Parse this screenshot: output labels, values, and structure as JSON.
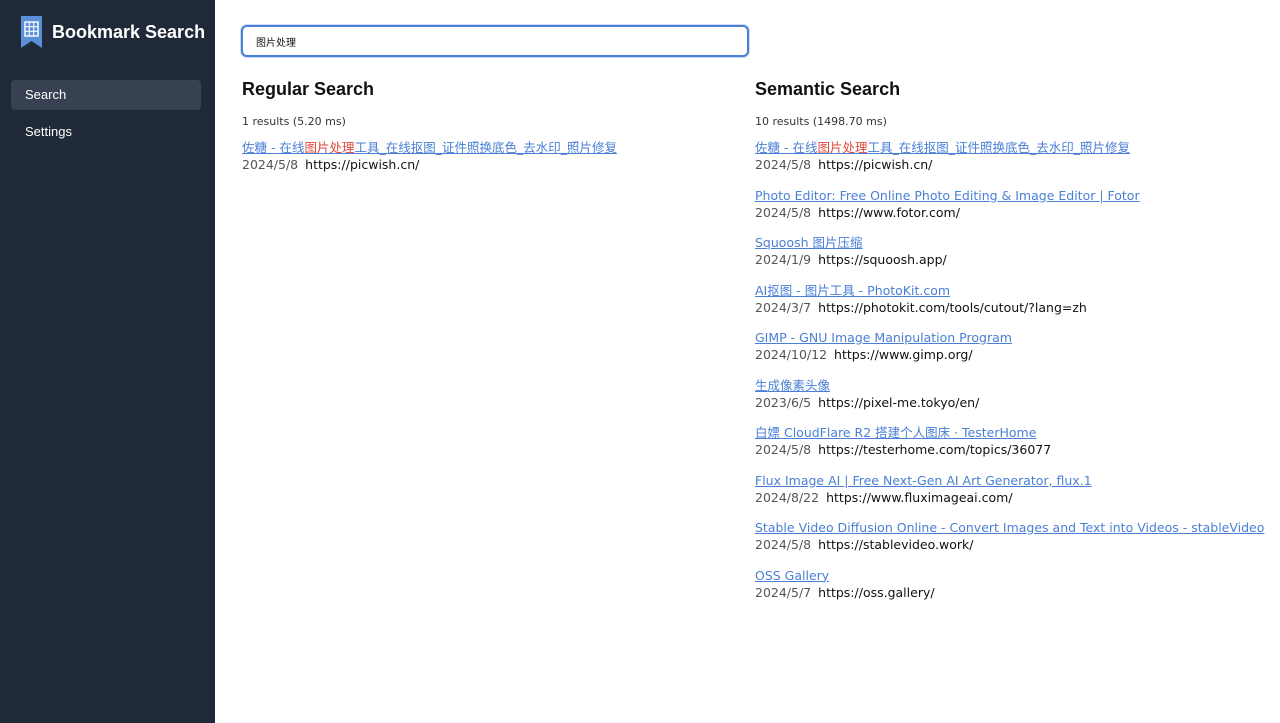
{
  "sidebar": {
    "title": "Bookmark Search",
    "nav": [
      {
        "label": "Search",
        "active": true
      },
      {
        "label": "Settings",
        "active": false
      }
    ]
  },
  "search": {
    "value": "图片处理"
  },
  "regular": {
    "heading": "Regular Search",
    "stats": "1 results (5.20 ms)",
    "results": [
      {
        "title_pre": "佐糖 - 在线",
        "title_hl": "图片处理",
        "title_post": "工具_在线抠图_证件照换底色_去水印_照片修复",
        "date": "2024/5/8",
        "url": "https://picwish.cn/"
      }
    ]
  },
  "semantic": {
    "heading": "Semantic Search",
    "stats": "10 results (1498.70 ms)",
    "results": [
      {
        "title_pre": "佐糖 - 在线",
        "title_hl": "图片处理",
        "title_post": "工具_在线抠图_证件照换底色_去水印_照片修复",
        "date": "2024/5/8",
        "url": "https://picwish.cn/"
      },
      {
        "title_pre": "Photo Editor: Free Online Photo Editing & Image Editor | Fotor",
        "title_hl": "",
        "title_post": "",
        "date": "2024/5/8",
        "url": "https://www.fotor.com/"
      },
      {
        "title_pre": "Squoosh 图片压缩",
        "title_hl": "",
        "title_post": "",
        "date": "2024/1/9",
        "url": "https://squoosh.app/"
      },
      {
        "title_pre": "AI抠图 - 图片工具 - PhotoKit.com",
        "title_hl": "",
        "title_post": "",
        "date": "2024/3/7",
        "url": "https://photokit.com/tools/cutout/?lang=zh"
      },
      {
        "title_pre": "GIMP - GNU Image Manipulation Program",
        "title_hl": "",
        "title_post": "",
        "date": "2024/10/12",
        "url": "https://www.gimp.org/"
      },
      {
        "title_pre": "生成像素头像",
        "title_hl": "",
        "title_post": "",
        "date": "2023/6/5",
        "url": "https://pixel-me.tokyo/en/"
      },
      {
        "title_pre": "白嫖 CloudFlare R2 搭建个人图床 · TesterHome",
        "title_hl": "",
        "title_post": "",
        "date": "2024/5/8",
        "url": "https://testerhome.com/topics/36077"
      },
      {
        "title_pre": "Flux Image AI | Free Next-Gen AI Art Generator, flux.1",
        "title_hl": "",
        "title_post": "",
        "date": "2024/8/22",
        "url": "https://www.fluximageai.com/"
      },
      {
        "title_pre": "Stable Video Diffusion Online - Convert Images and Text into Videos - stableVideo",
        "title_hl": "",
        "title_post": "",
        "date": "2024/5/8",
        "url": "https://stablevideo.work/"
      },
      {
        "title_pre": "OSS Gallery",
        "title_hl": "",
        "title_post": "",
        "date": "2024/5/7",
        "url": "https://oss.gallery/"
      }
    ]
  },
  "colors": {
    "link": "#4a7fd6",
    "highlight": "#e0473b",
    "sidebar_bg": "#1f2937",
    "nav_active": "#374151"
  },
  "icons": {
    "brand": "bookmark-grid-icon"
  }
}
